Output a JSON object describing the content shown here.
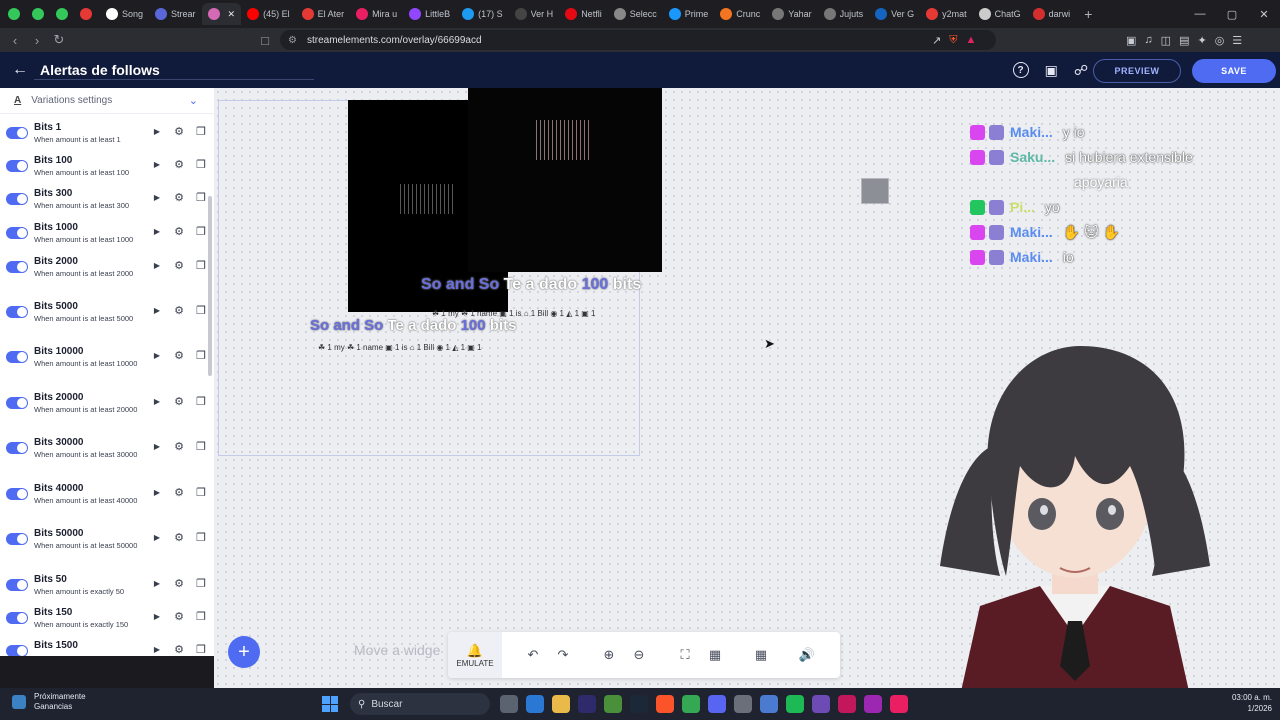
{
  "browser": {
    "tabs": [
      {
        "label": "",
        "color": "#34c759",
        "pinned": true
      },
      {
        "label": "",
        "color": "#34c759",
        "pinned": true
      },
      {
        "label": "",
        "color": "#34c759",
        "pinned": true
      },
      {
        "label": "",
        "color": "#e53935",
        "pinned": true
      },
      {
        "label": "Song",
        "color": "#ffffff"
      },
      {
        "label": "Strear",
        "color": "#5a67d8"
      },
      {
        "label": "",
        "color": "#d46ab6",
        "active": true
      },
      {
        "label": "(45) El",
        "color": "#ff0000"
      },
      {
        "label": "El Ater",
        "color": "#e53935"
      },
      {
        "label": "Mira u",
        "color": "#e91e63"
      },
      {
        "label": "LittleB",
        "color": "#9146ff"
      },
      {
        "label": "(17) S",
        "color": "#1d9bf0"
      },
      {
        "label": "Ver H",
        "color": "#444444"
      },
      {
        "label": "Netfli",
        "color": "#e50914"
      },
      {
        "label": "Selecc",
        "color": "#888888"
      },
      {
        "label": "Prime",
        "color": "#1a98ff"
      },
      {
        "label": "Crunc",
        "color": "#f47521"
      },
      {
        "label": "Yahar",
        "color": "#777777"
      },
      {
        "label": "Jujuts",
        "color": "#777777"
      },
      {
        "label": "Ver G",
        "color": "#1565c0"
      },
      {
        "label": "y2mat",
        "color": "#e53935"
      },
      {
        "label": "ChatG",
        "color": "#cccccc"
      },
      {
        "label": "darwi",
        "color": "#d32f2f"
      }
    ],
    "new_tab": "+",
    "url": "streamelements.com/overlay/66699acd"
  },
  "header": {
    "back": "←",
    "title": "Alertas de follows",
    "help": "?",
    "preview_label": "PREVIEW",
    "save_label": "SAVE"
  },
  "sidebar": {
    "section_title": "Variations settings",
    "section_icon": "A",
    "variations": [
      {
        "name": "Bits 1",
        "sub": "When amount is at least 1"
      },
      {
        "name": "Bits 100",
        "sub": "When amount is at least 100"
      },
      {
        "name": "Bits 300",
        "sub": "When amount is at least 300"
      },
      {
        "name": "Bits 1000",
        "sub": "When amount is at least 1000"
      },
      {
        "name": "Bits 2000",
        "sub": "When amount is at least 2000"
      },
      {
        "name": "Bits 5000",
        "sub": "When amount is at least 5000"
      },
      {
        "name": "Bits 10000",
        "sub": "When amount is at least 10000"
      },
      {
        "name": "Bits 20000",
        "sub": "When amount is at least 20000"
      },
      {
        "name": "Bits 30000",
        "sub": "When amount is at least 30000"
      },
      {
        "name": "Bits 40000",
        "sub": "When amount is at least 40000"
      },
      {
        "name": "Bits 50000",
        "sub": "When amount is at least 50000"
      },
      {
        "name": "Bits 50",
        "sub": "When amount is exactly 50"
      },
      {
        "name": "Bits 150",
        "sub": "When amount is exactly 150"
      },
      {
        "name": "Bits 1500",
        "sub": ""
      }
    ]
  },
  "canvas": {
    "alert_primary": {
      "name": "So and So",
      "pre": " Te a dado ",
      "amount": "100",
      "post": " bits"
    },
    "alert_secondary": {
      "name": "So and So",
      "pre": " Te a dado ",
      "amount": "100",
      "post": " bits"
    },
    "emotes_primary": "☘ 1 my ☘ 1 name ▣ 1 is ⌂ 1 Bill ◉ 1 ◭ 1 ▣ 1",
    "emotes_secondary": "☘ 1 my ☘ 1 name ▣ 1 is ⌂ 1 Bill ◉ 1 ◭ 1 ▣ 1",
    "placeholder": "Move a widge"
  },
  "chat": {
    "lines": [
      {
        "user": "Maki...",
        "user_color": "#5b8def",
        "badge": "#d946ef",
        "msg": "y io"
      },
      {
        "user": "Saku...",
        "user_color": "#5fb8a6",
        "badge": "#d946ef",
        "msg": "si hubiera extensible"
      },
      {
        "user": "",
        "user_color": "#ffffff",
        "badge": "",
        "msg": "apoyaria",
        "wrap": true
      },
      {
        "user": "Pi...",
        "user_color": "#c7e06a",
        "badge": "#22c55e",
        "msg": "yo"
      },
      {
        "user": "Maki...",
        "user_color": "#5b8def",
        "badge": "#d946ef",
        "msg": "✋ 🐱 ✋"
      },
      {
        "user": "Maki...",
        "user_color": "#5b8def",
        "badge": "#d946ef",
        "msg": "io"
      }
    ]
  },
  "toolbar": {
    "emulate_label": "EMULATE"
  },
  "taskbar": {
    "weather_line1": "Próximamente",
    "weather_line2": "Ganancias",
    "search_label": "Buscar",
    "time": "03:00 a. m.",
    "date": "1/2026"
  },
  "colors": {
    "accent": "#4e6bf2",
    "header_bg": "#101a3b"
  }
}
